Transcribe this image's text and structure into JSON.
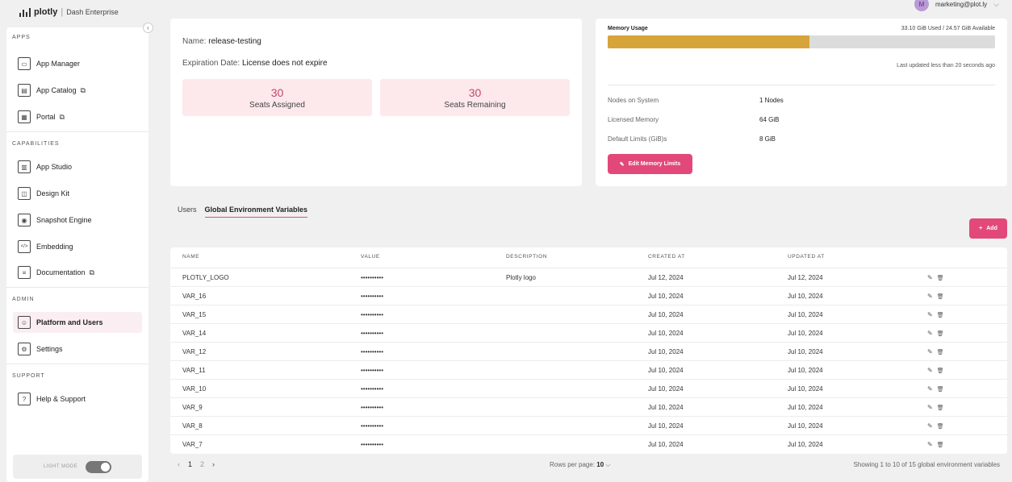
{
  "brand": {
    "name": "plotly",
    "product": "Dash Enterprise"
  },
  "user": {
    "initial": "M",
    "email": "marketing@plot.ly"
  },
  "sidebar": {
    "sections": [
      {
        "title": "APPS",
        "items": [
          {
            "label": "App Manager",
            "icon": "monitor-icon",
            "external": false
          },
          {
            "label": "App Catalog",
            "icon": "catalog-icon",
            "external": true
          },
          {
            "label": "Portal",
            "icon": "grid-icon",
            "external": true
          }
        ]
      },
      {
        "title": "CAPABILITIES",
        "items": [
          {
            "label": "App Studio",
            "icon": "layout-icon",
            "external": false
          },
          {
            "label": "Design Kit",
            "icon": "design-kit-icon",
            "external": false
          },
          {
            "label": "Snapshot Engine",
            "icon": "camera-icon",
            "external": false
          },
          {
            "label": "Embedding",
            "icon": "code-icon",
            "external": false
          },
          {
            "label": "Documentation",
            "icon": "document-icon",
            "external": true
          }
        ]
      },
      {
        "title": "ADMIN",
        "items": [
          {
            "label": "Platform and Users",
            "icon": "users-icon",
            "external": false,
            "active": true
          },
          {
            "label": "Settings",
            "icon": "gear-icon",
            "external": false
          }
        ]
      },
      {
        "title": "SUPPORT",
        "items": [
          {
            "label": "Help & Support",
            "icon": "help-icon",
            "external": false
          }
        ]
      }
    ],
    "light_mode_label": "LIGHT MODE"
  },
  "license": {
    "name_label": "Name:",
    "name_value": "release-testing",
    "expiration_label": "Expiration Date:",
    "expiration_value": "License does not expire",
    "seats_assigned": "30",
    "seats_assigned_label": "Seats Assigned",
    "seats_remaining": "30",
    "seats_remaining_label": "Seats Remaining"
  },
  "memory": {
    "title": "Memory Usage",
    "used_text": "33.10 GiB Used / 24.57 GiB Available",
    "usage_fraction": 0.52,
    "bar_color": "#d7a43a",
    "updated": "Last updated less than 20 seconds ago",
    "rows": [
      {
        "label": "Nodes on System",
        "value": "1 Nodes"
      },
      {
        "label": "Licensed Memory",
        "value": "64 GiB"
      },
      {
        "label": "Default Limits (GiB)s",
        "value": "8 GiB"
      }
    ],
    "edit_button": "Edit Memory Limits"
  },
  "tabs": [
    {
      "label": "Users",
      "active": false
    },
    {
      "label": "Global Environment Variables",
      "active": true
    }
  ],
  "add_button": "Add",
  "table": {
    "headers": [
      "NAME",
      "VALUE",
      "DESCRIPTION",
      "CREATED AT",
      "UPDATED AT"
    ],
    "rows": [
      {
        "name": "PLOTLY_LOGO",
        "value": "••••••••••",
        "description": "Plotly logo",
        "created": "Jul 12, 2024",
        "updated": "Jul 12, 2024"
      },
      {
        "name": "VAR_16",
        "value": "••••••••••",
        "description": "",
        "created": "Jul 10, 2024",
        "updated": "Jul 10, 2024"
      },
      {
        "name": "VAR_15",
        "value": "••••••••••",
        "description": "",
        "created": "Jul 10, 2024",
        "updated": "Jul 10, 2024"
      },
      {
        "name": "VAR_14",
        "value": "••••••••••",
        "description": "",
        "created": "Jul 10, 2024",
        "updated": "Jul 10, 2024"
      },
      {
        "name": "VAR_12",
        "value": "••••••••••",
        "description": "",
        "created": "Jul 10, 2024",
        "updated": "Jul 10, 2024"
      },
      {
        "name": "VAR_11",
        "value": "••••••••••",
        "description": "",
        "created": "Jul 10, 2024",
        "updated": "Jul 10, 2024"
      },
      {
        "name": "VAR_10",
        "value": "••••••••••",
        "description": "",
        "created": "Jul 10, 2024",
        "updated": "Jul 10, 2024"
      },
      {
        "name": "VAR_9",
        "value": "••••••••••",
        "description": "",
        "created": "Jul 10, 2024",
        "updated": "Jul 10, 2024"
      },
      {
        "name": "VAR_8",
        "value": "••••••••••",
        "description": "",
        "created": "Jul 10, 2024",
        "updated": "Jul 10, 2024"
      },
      {
        "name": "VAR_7",
        "value": "••••••••••",
        "description": "",
        "created": "Jul 10, 2024",
        "updated": "Jul 10, 2024"
      }
    ]
  },
  "pagination": {
    "pages": [
      "1",
      "2"
    ],
    "current": "1",
    "rows_per_page_label": "Rows per page:",
    "rows_per_page": "10",
    "showing": "Showing 1 to 10 of 15 global environment variables"
  }
}
